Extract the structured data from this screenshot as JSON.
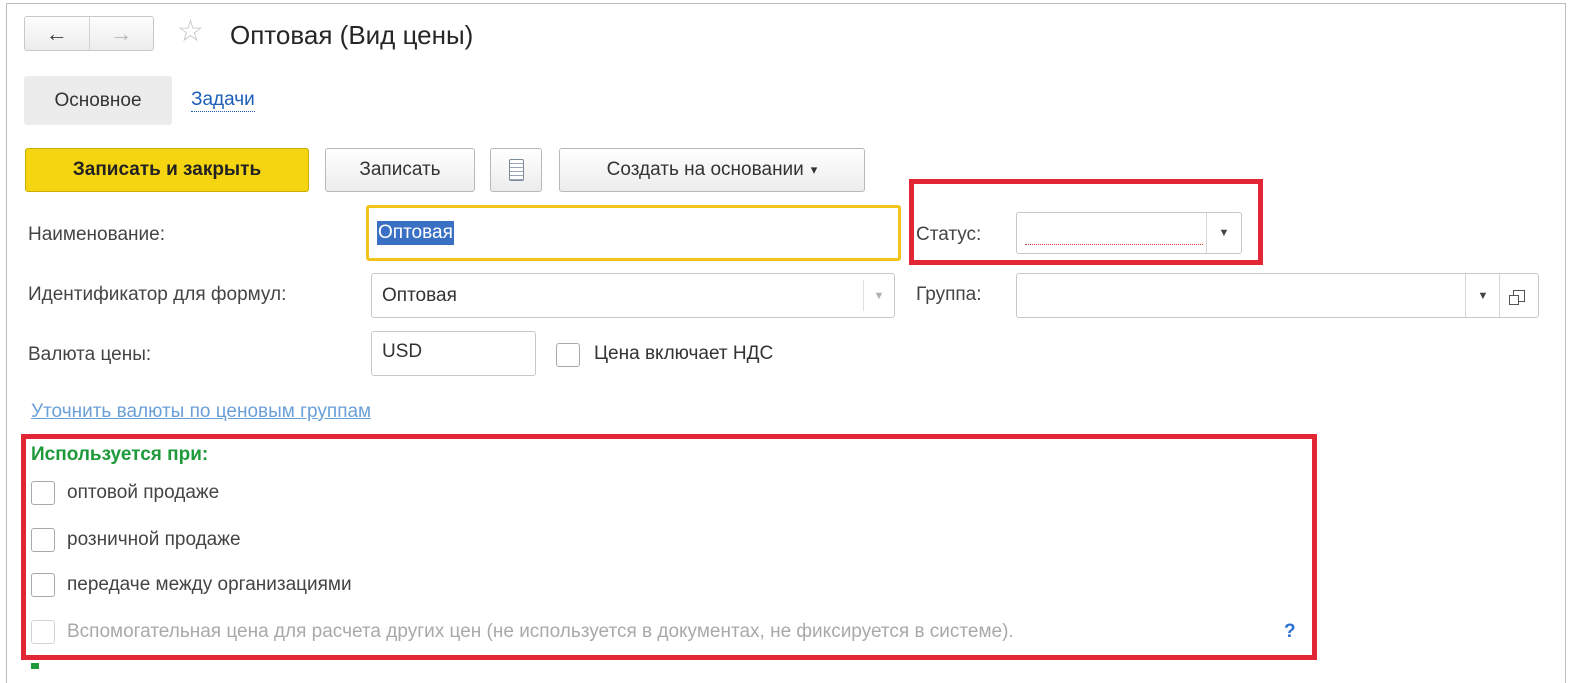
{
  "window": {
    "title": "Оптовая (Вид цены)"
  },
  "nav": {
    "back_icon": "←",
    "forward_icon": "→",
    "favorite_icon": "☆"
  },
  "tabs": [
    {
      "label": "Основное",
      "active": true
    },
    {
      "label": "Задачи",
      "active": false
    }
  ],
  "toolbar": {
    "save_close_label": "Записать и закрыть",
    "save_label": "Записать",
    "create_based_label": "Создать на основании",
    "create_based_arrow": "▾"
  },
  "form": {
    "name_label": "Наименование:",
    "name_value": "Оптовая",
    "status_label": "Статус:",
    "status_value": "",
    "id_label": "Идентификатор для формул:",
    "id_value": "Оптовая",
    "group_label": "Группа:",
    "group_value": "",
    "currency_label": "Валюта цены:",
    "currency_value": "USD",
    "vat_label": "Цена включает НДС",
    "vat_checked": false,
    "clarify_link": "Уточнить валюты по ценовым группам"
  },
  "usage": {
    "title": "Используется при:",
    "options": [
      {
        "label": "оптовой продаже",
        "checked": false,
        "enabled": true
      },
      {
        "label": "розничной продаже",
        "checked": false,
        "enabled": true
      },
      {
        "label": "передаче между организациями",
        "checked": false,
        "enabled": true
      },
      {
        "label": "Вспомогательная цена для расчета других цен (не используется в документах, не фиксируется в системе).",
        "checked": false,
        "enabled": false
      }
    ],
    "help_icon": "?"
  },
  "colors": {
    "primary_button": "#f5d512",
    "link": "#1c5db7",
    "section_title": "#1f9a3b",
    "highlight_box": "#e32636",
    "selection": "#3a70c4"
  }
}
